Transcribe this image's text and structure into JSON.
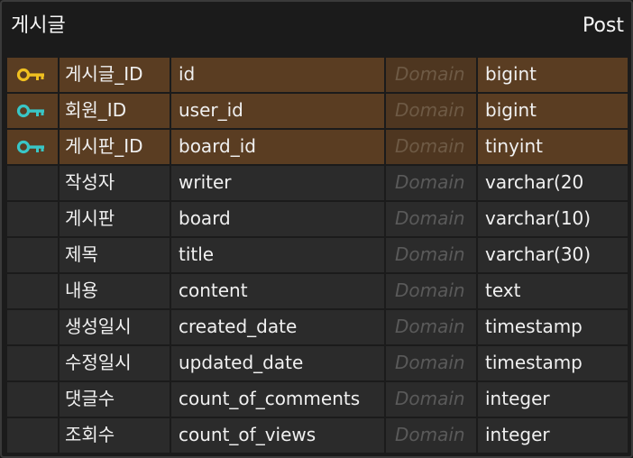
{
  "entity": {
    "logical_name": "게시글",
    "physical_name": "Post",
    "colors": {
      "primary_key": "#f0c020",
      "foreign_key": "#39c6c6",
      "key_row_bg": "#5a3d22",
      "row_bg": "#2b2b2b"
    },
    "columns": [
      {
        "key": "primary-key-icon",
        "logical": "게시글_ID",
        "physical": "id",
        "domain": "Domain",
        "type": "bigint"
      },
      {
        "key": "foreign-key-icon",
        "logical": "회원_ID",
        "physical": "user_id",
        "domain": "Domain",
        "type": "bigint"
      },
      {
        "key": "foreign-key-icon",
        "logical": "게시판_ID",
        "physical": "board_id",
        "domain": "Domain",
        "type": "tinyint"
      },
      {
        "key": "",
        "logical": "작성자",
        "physical": "writer",
        "domain": "Domain",
        "type": "varchar(20"
      },
      {
        "key": "",
        "logical": "게시판",
        "physical": "board",
        "domain": "Domain",
        "type": "varchar(10)"
      },
      {
        "key": "",
        "logical": "제목",
        "physical": "title",
        "domain": "Domain",
        "type": "varchar(30)"
      },
      {
        "key": "",
        "logical": "내용",
        "physical": "content",
        "domain": "Domain",
        "type": "text"
      },
      {
        "key": "",
        "logical": "생성일시",
        "physical": "created_date",
        "domain": "Domain",
        "type": "timestamp"
      },
      {
        "key": "",
        "logical": "수정일시",
        "physical": "updated_date",
        "domain": "Domain",
        "type": "timestamp"
      },
      {
        "key": "",
        "logical": "댓글수",
        "physical": "count_of_comments",
        "domain": "Domain",
        "type": "integer"
      },
      {
        "key": "",
        "logical": "조회수",
        "physical": "count_of_views",
        "domain": "Domain",
        "type": "integer"
      }
    ]
  }
}
